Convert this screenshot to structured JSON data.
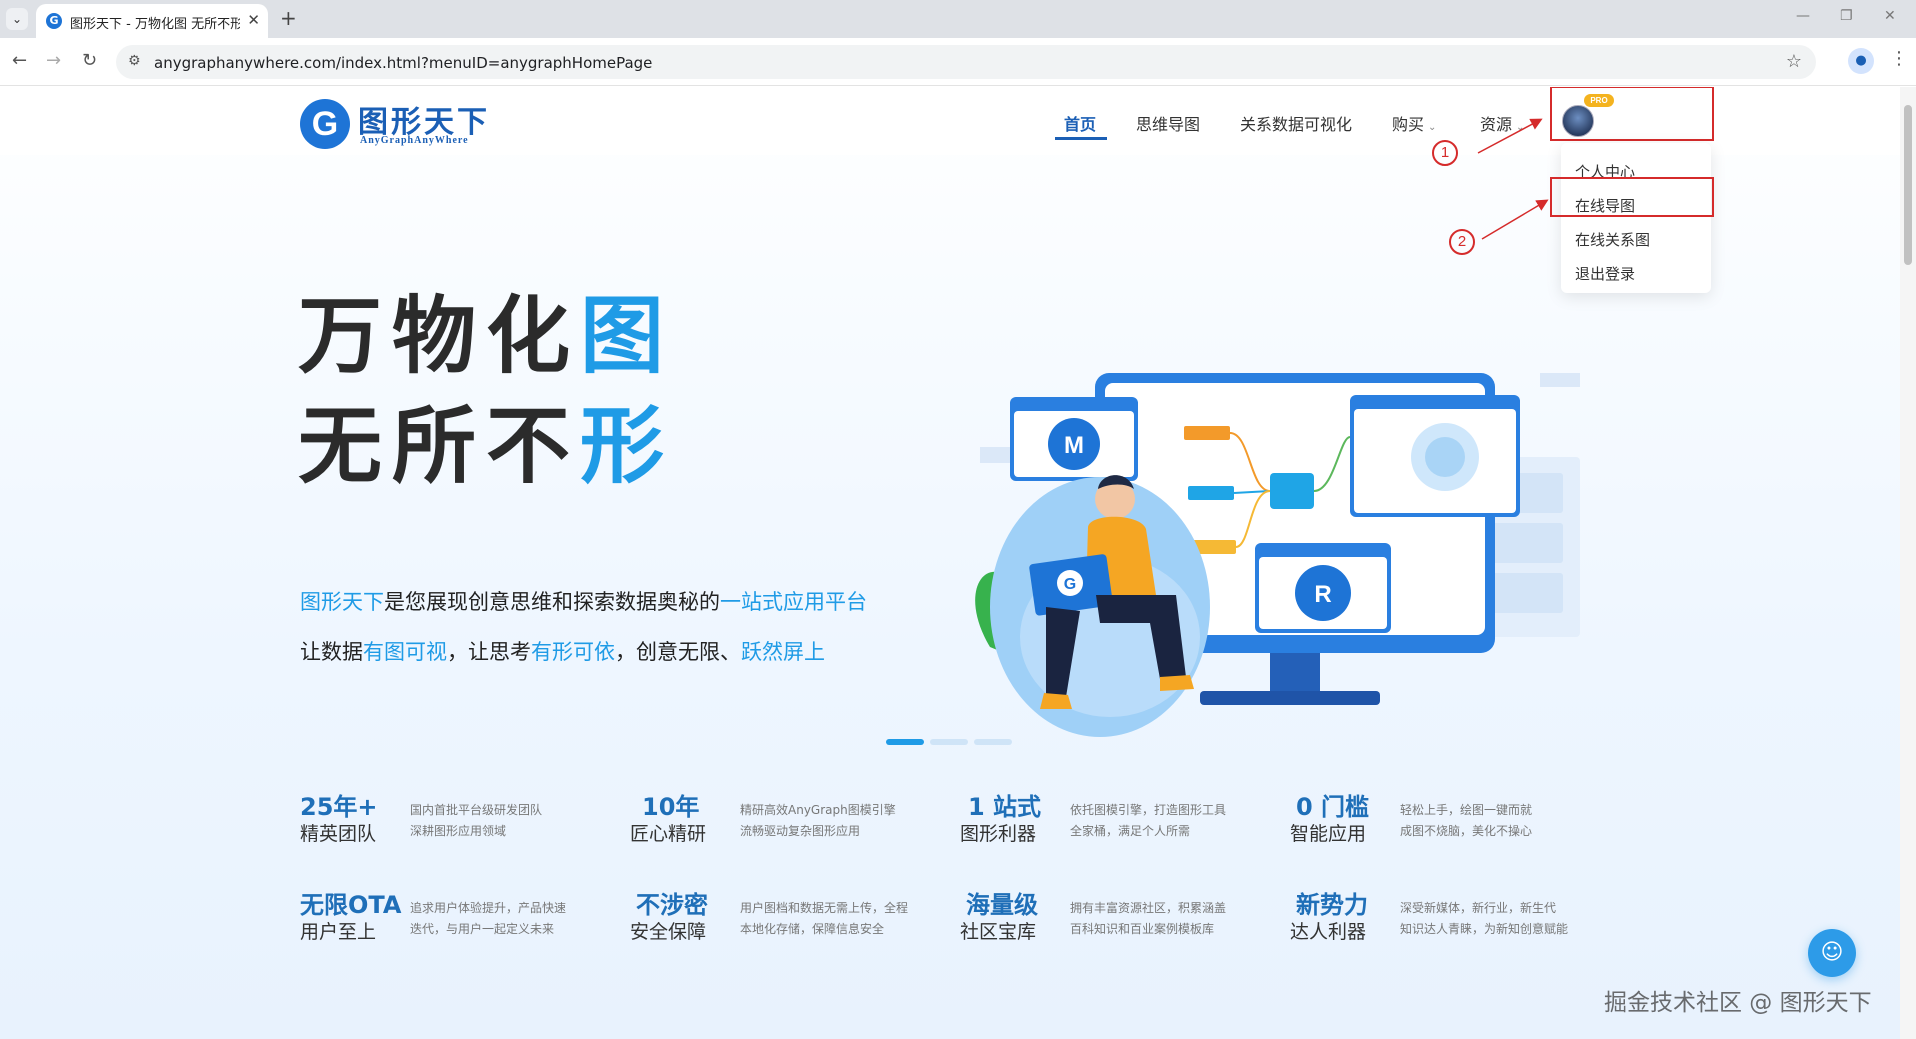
{
  "browser": {
    "tab_title": "图形天下 - 万物化图 无所不形",
    "url": "anygraphanywhere.com/index.html?menuID=anygraphHomePage",
    "icons": {
      "tab_list": "chevron-down-icon",
      "tab_close": "close-icon",
      "new_tab": "plus-icon",
      "back": "back-arrow-icon",
      "forward": "forward-arrow-icon",
      "reload": "reload-icon",
      "site_info": "tune-icon",
      "bookmark": "star-icon",
      "profile": "person-icon",
      "menu": "kebab-menu-icon"
    }
  },
  "site": {
    "logo_cn": "图形天下",
    "logo_en": "AnyGraphAnyWhere",
    "logo_letter": "G",
    "nav": [
      {
        "label": "首页",
        "active": true
      },
      {
        "label": "思维导图",
        "active": false
      },
      {
        "label": "关系数据可视化",
        "active": false
      },
      {
        "label": "购买",
        "active": false,
        "dropdown": true
      },
      {
        "label": "资源",
        "active": false,
        "dropdown": true
      }
    ],
    "pro_badge": "PRO",
    "user_menu": [
      "个人中心",
      "在线导图",
      "在线关系图",
      "退出登录"
    ],
    "annotations": {
      "marker_1": "1",
      "marker_2": "2"
    }
  },
  "hero": {
    "line1_dark": "万物化",
    "line1_accent": "图",
    "line2_dark": "无所不",
    "line2_accent": "形",
    "tagline1": {
      "part1": "图形天下",
      "part2": "是您展现创意思维和探索数据奥秘的",
      "part3": "一站式应用平台"
    },
    "tagline2": {
      "part1": "让数据",
      "part2": "有图可视",
      "part3": "，让思考",
      "part4": "有形可依",
      "part5": "，创意无限、",
      "part6": "跃然屏上"
    },
    "illustration_labels": {
      "m_logo": "M",
      "r_logo": "R",
      "laptop_logo": "G"
    },
    "carousel": {
      "count": 3,
      "active_index": 0
    }
  },
  "stats": [
    {
      "big": "25年+",
      "label": "精英团队",
      "desc1": "国内首批平台级研发团队",
      "desc2": "深耕图形应用领域"
    },
    {
      "big": "10年",
      "label": "匠心精研",
      "desc1": "精研高效AnyGraph图模引擎",
      "desc2": "流畅驱动复杂图形应用"
    },
    {
      "big": "1 站式",
      "label": "图形利器",
      "desc1": "依托图模引擎，打造图形工具",
      "desc2": "全家桶，满足个人所需"
    },
    {
      "big": "0 门槛",
      "label": "智能应用",
      "desc1": "轻松上手，绘图一键而就",
      "desc2": "成图不烧脑，美化不操心"
    },
    {
      "big": "无限OTA",
      "label": "用户至上",
      "desc1": "追求用户体验提升，产品快速",
      "desc2": "迭代，与用户一起定义未来"
    },
    {
      "big": "不涉密",
      "label": "安全保障",
      "desc1": "用户图档和数据无需上传，全程",
      "desc2": "本地化存储，保障信息安全"
    },
    {
      "big": "海量级",
      "label": "社区宝库",
      "desc1": "拥有丰富资源社区，积累涵盖",
      "desc2": "百科知识和百业案例模板库"
    },
    {
      "big": "新势力",
      "label": "达人利器",
      "desc1": "深受新媒体，新行业，新生代",
      "desc2": "知识达人青睐，为新知创意赋能"
    }
  ],
  "widgets": {
    "chat_icon": "smile-chat-icon"
  },
  "watermark": "掘金技术社区 @ 图形天下",
  "colors": {
    "brand": "#1b5fb5",
    "accent": "#1f9be6",
    "annotation": "#d52b2b",
    "pro": "#f4b31f"
  }
}
